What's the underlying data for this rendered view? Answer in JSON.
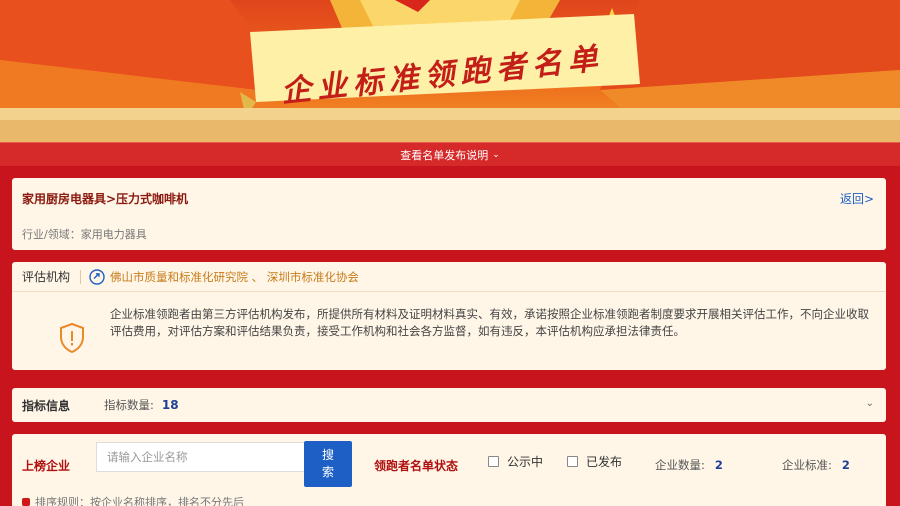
{
  "banner": {
    "title": "企业标准领跑者名单"
  },
  "notice": {
    "text": "查看名单发布说明",
    "chevron": "chevron-down-icon"
  },
  "category": {
    "path": "家用厨房电器具>压力式咖啡机",
    "back": "返回>",
    "industry_label": "行业/领域：",
    "industry_value": "家用电力器具"
  },
  "evaluators": {
    "label": "评估机构",
    "icon": "link-icon",
    "orgs": "佛山市质量和标准化研究院 、 深圳市标准化协会",
    "disclaimer": "企业标准领跑者由第三方评估机构发布，所提供所有材料及证明材料真实、有效，承诺按照企业标准领跑者制度要求开展相关评估工作，不向企业收取评估费用，对评估方案和评估结果负责，接受工作机构和社会各方监督，如有违反，本评估机构应承担法律责任。",
    "shield_icon": "shield-alert-icon"
  },
  "indicators": {
    "label": "指标信息",
    "count_label": "指标数量:",
    "count": "18"
  },
  "companies": {
    "label": "上榜企业",
    "search_placeholder": "请输入企业名称",
    "search_button": "搜索",
    "status_label": "领跑者名单状态",
    "opt_public": "公示中",
    "opt_published": "已发布",
    "company_count_label": "企业数量:",
    "company_count": "2",
    "standard_count_label": "企业标准:",
    "standard_count": "2",
    "rule_text": "排序规则：按企业名称排序，排名不分先后"
  },
  "colors": {
    "primary_red": "#c8141c",
    "accent_blue": "#1d5fc4",
    "card_bg": "#fff6e8",
    "org_gold": "#c77c1a"
  }
}
